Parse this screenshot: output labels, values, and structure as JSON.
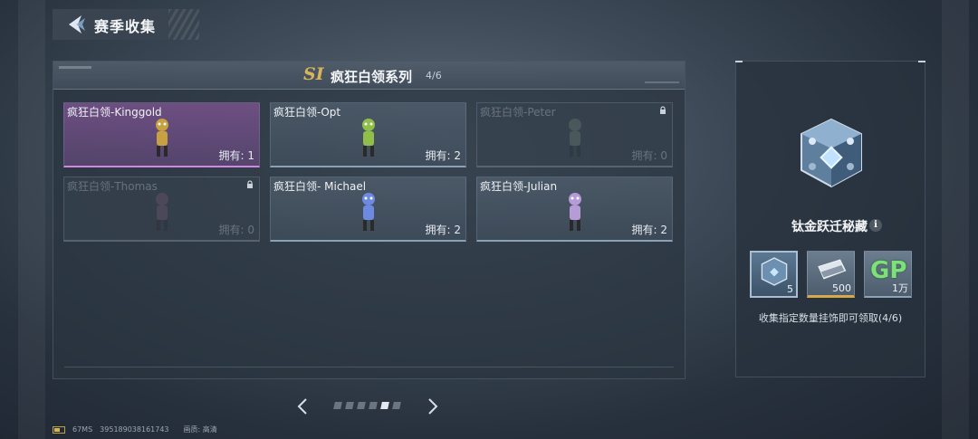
{
  "header": {
    "title": "赛季收集"
  },
  "series": {
    "badge": "SI",
    "title": "疯狂白领系列",
    "count": "4/6"
  },
  "cards": [
    {
      "name": "疯狂白领-Kinggold",
      "owned": "拥有: 1",
      "state": "selected",
      "color": "#c7a042"
    },
    {
      "name": "疯狂白领-Opt",
      "owned": "拥有: 2",
      "state": "owned",
      "color": "#8fbf4a"
    },
    {
      "name": "疯狂白领-Peter",
      "owned": "拥有: 0",
      "state": "locked",
      "color": "#7d8a7d"
    },
    {
      "name": "疯狂白领-Thomas",
      "owned": "拥有: 0",
      "state": "locked",
      "color": "#8a5f7a"
    },
    {
      "name": "疯狂白领- Michael",
      "owned": "拥有: 2",
      "state": "owned",
      "color": "#6e8ae0"
    },
    {
      "name": "疯狂白领-Julian",
      "owned": "拥有: 2",
      "state": "owned",
      "color": "#b79ad8"
    }
  ],
  "pager": {
    "total": 6,
    "active_index": 4
  },
  "reward": {
    "title": "钛金跃迁秘藏",
    "info_icon": "i",
    "items": [
      {
        "icon": "titanium-box-icon",
        "count": "5"
      },
      {
        "icon": "voucher-icon",
        "count": "500"
      },
      {
        "icon": "gp-coin-icon",
        "label": "GP",
        "count": "1万"
      }
    ],
    "description": "收集指定数量挂饰即可领取(4/6)"
  },
  "status_bar": {
    "latency": "67MS",
    "player_id": "395189038161743",
    "quality": "画质: 高清"
  }
}
